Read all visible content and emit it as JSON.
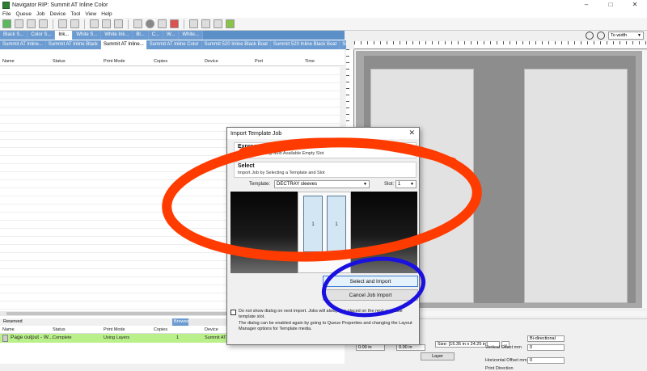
{
  "window": {
    "title": "Navigator RIP: Summit AT Inline Color",
    "minimize": "–",
    "maximize": "□",
    "close": "✕"
  },
  "menu": [
    "File",
    "Queue",
    "Job",
    "Device",
    "Tool",
    "View",
    "Help"
  ],
  "toolbar": {
    "buttons": [
      "new",
      "open",
      "delete",
      "save",
      "print",
      "layout",
      "preview",
      "zoom-in",
      "stop",
      "color",
      "queue",
      "refresh",
      "order",
      "palette"
    ]
  },
  "ink_tabs": [
    "Black S...",
    "Color S...",
    "Ink...",
    "White S...",
    "White Ink...",
    "Bl...",
    "C...",
    "W...",
    "White..."
  ],
  "queue_tabs": [
    "Summit AT Inline...",
    "Summit AT Inline Black",
    "Summit AT Inline...",
    "Summit AT Inline Color",
    "Summit 520 Inline Black Boat",
    "Summit 520 Inline Black Boat",
    "Summit S..."
  ],
  "queue_tabs_arrows": "◄ ►",
  "columns": [
    "Name",
    "Status",
    "Print Mode",
    "Copies",
    "Device",
    "Port",
    "Time"
  ],
  "lower_tabs": {
    "reserved": "Reserved",
    "browse": "Browse"
  },
  "jobs": [
    {
      "name": "Page output - W...",
      "status": "Complete",
      "print_mode": "Using Layers",
      "copies": "1",
      "device": "Summit AT I"
    }
  ],
  "zoom": {
    "value": "To width"
  },
  "properties": {
    "size": "Size: [15.35 in x 24.25 in]",
    "size_btn": "...",
    "horizontal_offset_label": "Horizontal Offset mm",
    "horizontal_offset": "0",
    "print_direction_label": "Print Direction",
    "print_direction": "Bi-directional",
    "vertical_offset_label": "Vertical Offset mm",
    "vertical_offset": "0",
    "x_value": "0.00 in",
    "y_value": "0.00 in",
    "layer_button": "Layer"
  },
  "dialog": {
    "title": "Import Template Job",
    "close": "✕",
    "express_title": "Express",
    "express_desc": "Import Job Filling Next Available Empty Slot",
    "select_title": "Select",
    "select_desc": "Import Job by Selecting a Template and Slot",
    "template_label": "Template:",
    "template_value": "DECTRAY sleeves",
    "slot_label": "Slot:",
    "slot_value": "1",
    "slots": [
      "1",
      "1"
    ],
    "select_import_button": "Select and Import",
    "cancel_button": "Cancel Job Import",
    "checkbox_text": "Do not show dialog on next import. Jobs will always be placed on the next available template slot.",
    "footer_note": "The dialog can be enabled again by going to Queue Properties and changing the Layout Manager options for Template media."
  },
  "colors": {
    "tab_blue": "#5b8fc7",
    "job_row_green": "#b9f08a",
    "annotation_red": "#ff3b00",
    "annotation_blue": "#1a10e0"
  }
}
